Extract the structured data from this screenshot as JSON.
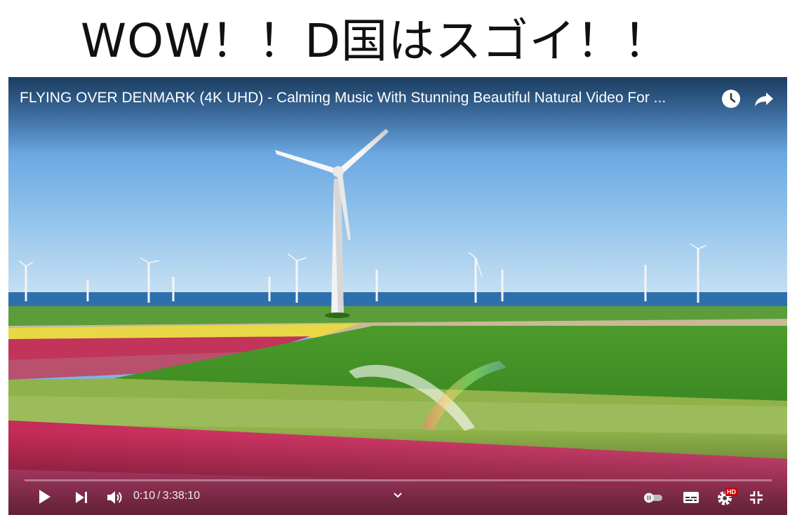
{
  "caption": "WOW！！D国はスゴイ！！",
  "player": {
    "title": "FLYING OVER DENMARK (4K UHD) - Calming Music With Stunning Beautiful Natural Video For ...",
    "current_time": "0:10",
    "duration": "3:38:10",
    "separator": "/",
    "progress_played_fraction": 0.001,
    "progress_loaded_fraction": 0.0,
    "autoplay_on": false,
    "hd_badge": "HD",
    "icons": {
      "watch_later": "clock-icon",
      "share": "share-arrow-icon",
      "play": "play-icon",
      "next": "skip-next-icon",
      "volume": "volume-icon",
      "chevron": "chevron-down-icon",
      "autoplay": "autoplay-toggle-icon",
      "subtitles": "subtitles-icon",
      "settings": "gear-icon",
      "exit_fullscreen": "exit-fullscreen-icon"
    },
    "colors": {
      "progress_played": "#ff0000",
      "hd_badge": "#cc0000"
    }
  }
}
